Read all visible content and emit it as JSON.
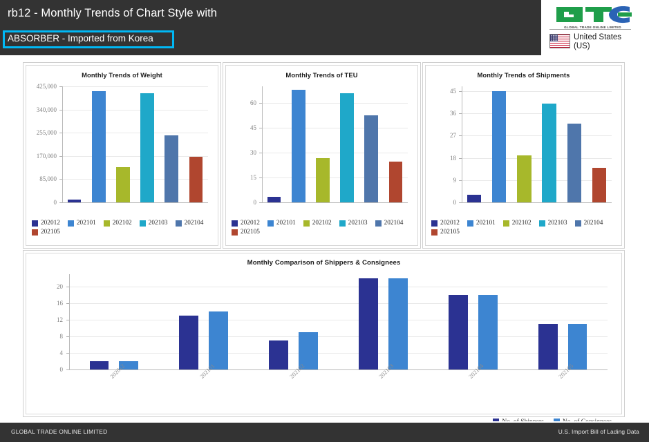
{
  "header": {
    "title": "rb12 - Monthly Trends of Chart Style with",
    "subtitle": "ABSORBER - Imported from Korea",
    "highlight_color": "#00b8f5",
    "logo_text": "GTO",
    "logo_tagline": "GLOBAL TRADE ONLINE LIMITED",
    "country": "United States",
    "country_code": "(US)"
  },
  "footer": {
    "left": "GLOBAL TRADE ONLINE LIMITED",
    "right": "U.S. Import Bill of Lading Data"
  },
  "series_colors": {
    "202012": "#2b3292",
    "202101": "#3d85d1",
    "202102": "#a7b82b",
    "202103": "#1fa8c9",
    "202104": "#4f76ab",
    "202105": "#b0462f",
    "shippers": "#2b3292",
    "consignees": "#3d85d1"
  },
  "charts": [
    {
      "id": "weight",
      "title": "Monthly Trends of Weight",
      "legend": [
        "202012",
        "202101",
        "202102",
        "202103",
        "202104",
        "202105"
      ]
    },
    {
      "id": "teu",
      "title": "Monthly Trends of TEU",
      "legend": [
        "202012",
        "202101",
        "202102",
        "202103",
        "202104",
        "202105"
      ]
    },
    {
      "id": "shipments",
      "title": "Monthly Trends of Shipments",
      "legend": [
        "202012",
        "202101",
        "202102",
        "202103",
        "202104",
        "202105"
      ]
    }
  ],
  "bottom_chart": {
    "title": "Monthly Comparison of Shippers & Consignees",
    "legend": [
      "No. of Shippers",
      "No. of Consignees"
    ]
  },
  "chart_data": [
    {
      "type": "bar",
      "id": "weight",
      "title": "Monthly Trends of Weight",
      "xlabel": "",
      "ylabel": "",
      "categories": [
        "202012",
        "202101",
        "202102",
        "202103",
        "202104",
        "202105"
      ],
      "values": [
        10000,
        408000,
        128000,
        400000,
        245000,
        168000
      ],
      "ytick_labels": [
        "0",
        "85,000",
        "170,000",
        "255,000",
        "340,000",
        "425,000"
      ],
      "yticks": [
        0,
        85000,
        170000,
        255000,
        340000,
        425000
      ],
      "ylim": [
        0,
        425000
      ],
      "grid": true,
      "legend_position": "bottom",
      "colors": [
        "#2b3292",
        "#3d85d1",
        "#a7b82b",
        "#1fa8c9",
        "#4f76ab",
        "#b0462f"
      ]
    },
    {
      "type": "bar",
      "id": "teu",
      "title": "Monthly Trends of TEU",
      "xlabel": "",
      "ylabel": "",
      "categories": [
        "202012",
        "202101",
        "202102",
        "202103",
        "202104",
        "202105"
      ],
      "values": [
        3.5,
        68,
        26.5,
        66,
        52.5,
        24.5
      ],
      "ytick_labels": [
        "0",
        "15",
        "30",
        "45",
        "60"
      ],
      "yticks": [
        0,
        15,
        30,
        45,
        60
      ],
      "ylim": [
        0,
        70
      ],
      "grid": true,
      "legend_position": "bottom",
      "colors": [
        "#2b3292",
        "#3d85d1",
        "#a7b82b",
        "#1fa8c9",
        "#4f76ab",
        "#b0462f"
      ]
    },
    {
      "type": "bar",
      "id": "shipments",
      "title": "Monthly Trends of Shipments",
      "xlabel": "",
      "ylabel": "",
      "categories": [
        "202012",
        "202101",
        "202102",
        "202103",
        "202104",
        "202105"
      ],
      "values": [
        3,
        45,
        19,
        40,
        32,
        14
      ],
      "ytick_labels": [
        "0",
        "9",
        "18",
        "27",
        "36",
        "45"
      ],
      "yticks": [
        0,
        9,
        18,
        27,
        36,
        45
      ],
      "ylim": [
        0,
        47
      ],
      "grid": true,
      "legend_position": "bottom",
      "colors": [
        "#2b3292",
        "#3d85d1",
        "#a7b82b",
        "#1fa8c9",
        "#4f76ab",
        "#b0462f"
      ]
    },
    {
      "type": "bar",
      "id": "shippers_consignees",
      "title": "Monthly Comparison of Shippers & Consignees",
      "xlabel": "",
      "ylabel": "",
      "categories": [
        "202012",
        "202101",
        "202102",
        "202103",
        "202104",
        "202105"
      ],
      "series": [
        {
          "name": "No. of Shippers",
          "values": [
            2,
            13,
            7,
            22,
            18,
            11
          ],
          "color": "#2b3292"
        },
        {
          "name": "No. of Consignees",
          "values": [
            2,
            14,
            9,
            22,
            18,
            11
          ],
          "color": "#3d85d1"
        }
      ],
      "ytick_labels": [
        "0",
        "4",
        "8",
        "12",
        "16",
        "20"
      ],
      "yticks": [
        0,
        4,
        8,
        12,
        16,
        20
      ],
      "ylim": [
        0,
        23
      ],
      "grid": true,
      "legend_position": "bottom-right"
    }
  ]
}
